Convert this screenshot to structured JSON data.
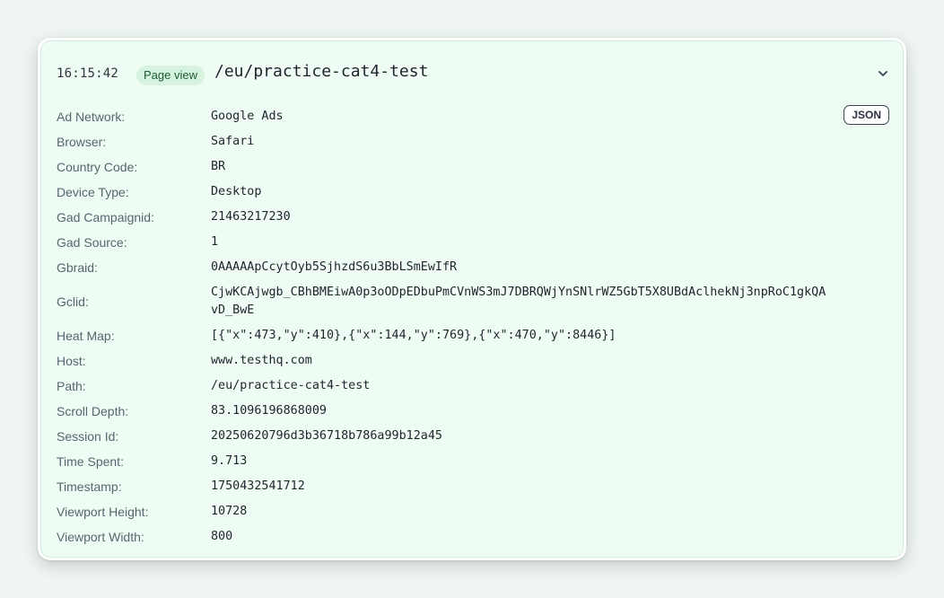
{
  "event": {
    "time": "16:15:42",
    "type_badge": "Page view",
    "path": "/eu/practice-cat4-test",
    "json_label": "JSON"
  },
  "icons": {
    "collapse": "chevron-down-icon"
  },
  "colors": {
    "card_bg": "#effcf3",
    "badge_bg": "#d6f3df",
    "badge_text": "#1a5e36",
    "page_bg": "#eef5f2"
  },
  "properties": [
    {
      "label": "Ad Network:",
      "value": "Google Ads"
    },
    {
      "label": "Browser:",
      "value": "Safari"
    },
    {
      "label": "Country Code:",
      "value": "BR"
    },
    {
      "label": "Device Type:",
      "value": "Desktop"
    },
    {
      "label": "Gad Campaignid:",
      "value": "21463217230"
    },
    {
      "label": "Gad Source:",
      "value": "1"
    },
    {
      "label": "Gbraid:",
      "value": "0AAAAApCcytOyb5SjhzdS6u3BbLSmEwIfR"
    },
    {
      "label": "Gclid:",
      "value": "CjwKCAjwgb_CBhBMEiwA0p3oODpEDbuPmCVnWS3mJ7DBRQWjYnSNlrWZ5GbT5X8UBdAclhekNj3npRoC1gkQAvD_BwE"
    },
    {
      "label": "Heat Map:",
      "value": "[{\"x\":473,\"y\":410},{\"x\":144,\"y\":769},{\"x\":470,\"y\":8446}]"
    },
    {
      "label": "Host:",
      "value": "www.testhq.com"
    },
    {
      "label": "Path:",
      "value": "/eu/practice-cat4-test"
    },
    {
      "label": "Scroll Depth:",
      "value": "83.1096196868009"
    },
    {
      "label": "Session Id:",
      "value": "20250620796d3b36718b786a99b12a45"
    },
    {
      "label": "Time Spent:",
      "value": "9.713"
    },
    {
      "label": "Timestamp:",
      "value": "1750432541712"
    },
    {
      "label": "Viewport Height:",
      "value": "10728"
    },
    {
      "label": "Viewport Width:",
      "value": "800"
    }
  ]
}
